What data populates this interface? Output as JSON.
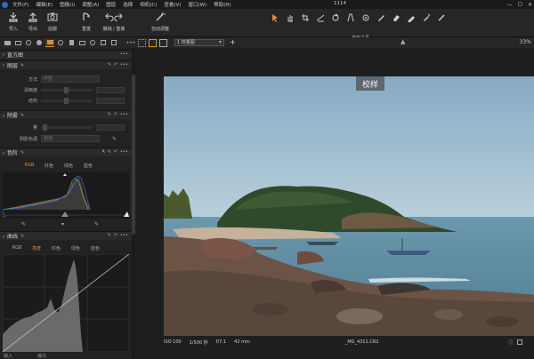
{
  "window": {
    "title": "1114",
    "controls": [
      "—",
      "☐",
      "✕"
    ]
  },
  "menu": [
    "文件(F)",
    "编辑(E)",
    "图像(I)",
    "调整(A)",
    "图层",
    "选择",
    "相机(C)",
    "查看(V)",
    "窗口(W)",
    "帮助(H)"
  ],
  "toolbar": {
    "import_label": "导入",
    "export_label": "导出",
    "capture_label": "拍摄",
    "reset_label": "重置",
    "undo_redo_label": "撤销 / 重做",
    "auto_adjust_label": "自动调整",
    "cursor_tools_label": "光标工具"
  },
  "viewer": {
    "view_select": "1 校量图",
    "zoom": "33%",
    "photo_title": "校样",
    "info": {
      "iso": "ISO 100",
      "shutter": "1/500 秒",
      "aperture": "f/7.1",
      "focal": "42 mm",
      "filename": "_MG_4311.CR2"
    }
  },
  "panel": {
    "sections": {
      "histogram": "直方图",
      "layers": "图层",
      "denoise": "除雾",
      "levels": "色阶",
      "curves": "曲线"
    },
    "layers": {
      "method_label": "方法",
      "method_value": "中性",
      "opacity_label": "清晰度",
      "structure_label": "结构"
    },
    "denoise": {
      "amount_label": "量",
      "shadow_color_label": "阴影色调",
      "shadow_color_value": "自动"
    },
    "levels_channels": [
      "RGB",
      "红色",
      "绿色",
      "蓝色"
    ],
    "curves_channels": [
      "RGB",
      "亮度",
      "红色",
      "绿色",
      "蓝色"
    ],
    "footer": {
      "input": "输入",
      "output": "输出"
    }
  },
  "colors": {
    "accent": "#e48a2e",
    "sky": "#8fb2c8",
    "sea": "#5f8ea3"
  }
}
